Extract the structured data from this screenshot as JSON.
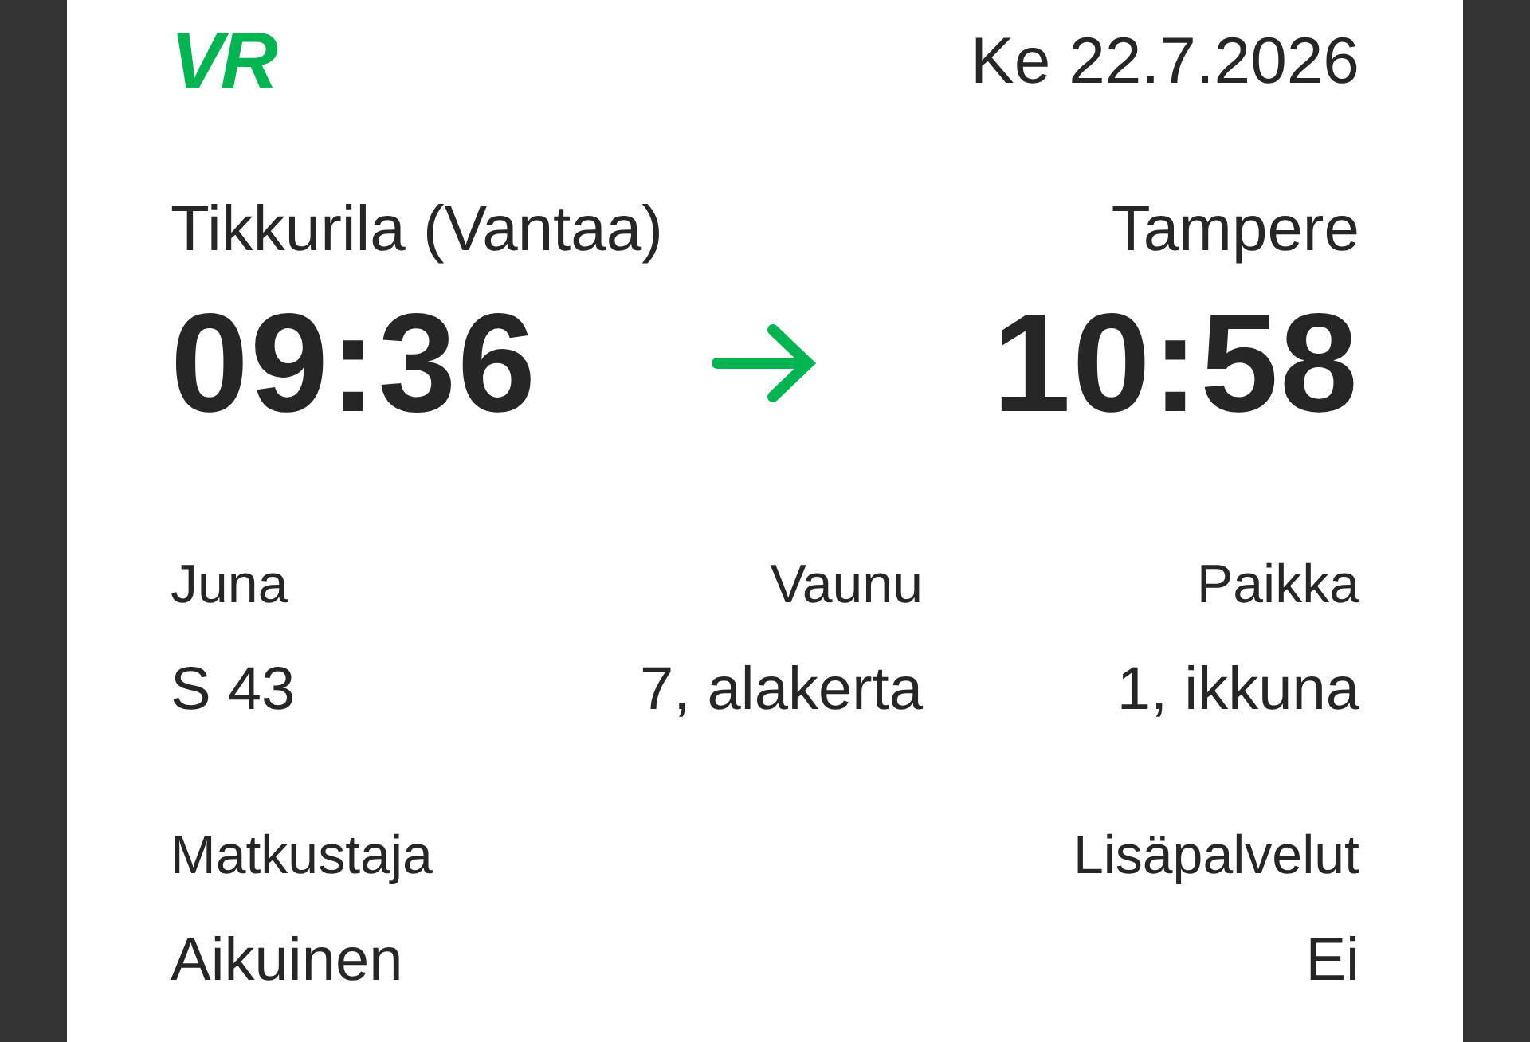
{
  "logo": {
    "text": "VR"
  },
  "date": "Ke 22.7.2026",
  "journey": {
    "from": {
      "station": "Tikkurila (Vantaa)",
      "time": "09:36"
    },
    "to": {
      "station": "Tampere",
      "time": "10:58"
    }
  },
  "details": [
    {
      "label": "Juna",
      "value": "S 43"
    },
    {
      "label": "Vaunu",
      "value": "7, alakerta"
    },
    {
      "label": "Paikka",
      "value": "1, ikkuna"
    }
  ],
  "extras": [
    {
      "label": "Matkustaja",
      "value": "Aikuinen"
    },
    {
      "label": "Lisäpalvelut",
      "value": "Ei"
    }
  ]
}
